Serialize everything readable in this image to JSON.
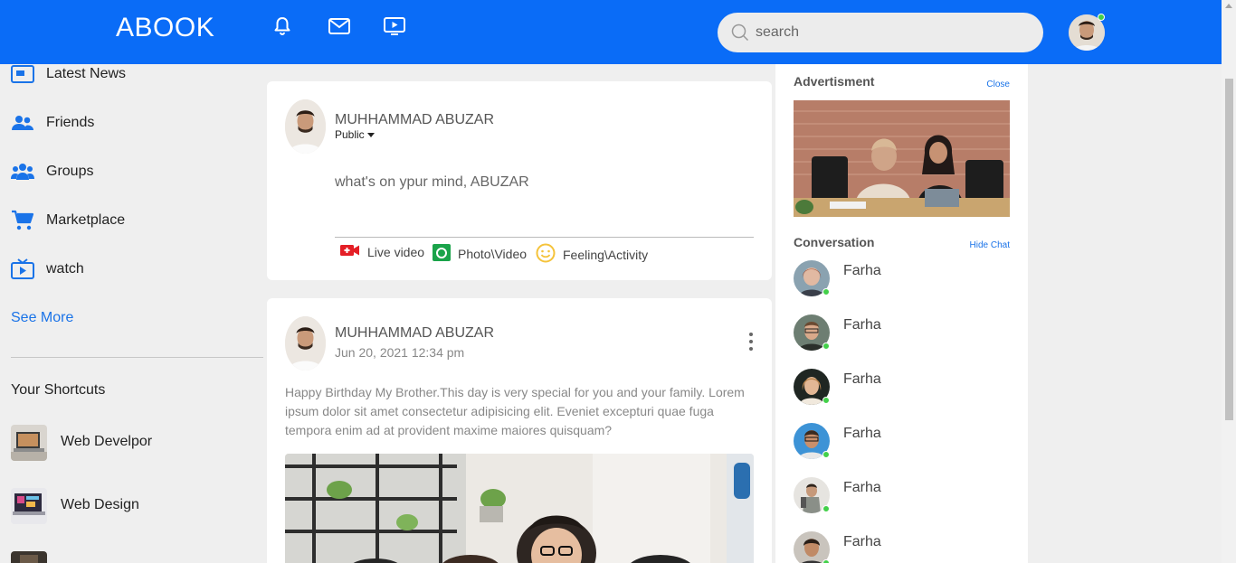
{
  "header": {
    "logo": "ABOOK",
    "icons": [
      "bell-icon",
      "mail-icon",
      "tv-icon"
    ],
    "search_placeholder": "search",
    "accent": "#0a6cf7"
  },
  "sidebar": {
    "items": [
      {
        "label": "Latest News",
        "icon": "news-icon"
      },
      {
        "label": "Friends",
        "icon": "friends-icon"
      },
      {
        "label": "Groups",
        "icon": "groups-icon"
      },
      {
        "label": "Marketplace",
        "icon": "cart-icon"
      },
      {
        "label": "watch",
        "icon": "watch-icon"
      }
    ],
    "see_more": "See More",
    "shortcuts_title": "Your Shortcuts",
    "shortcuts": [
      {
        "label": "Web Develpor"
      },
      {
        "label": "Web Design"
      }
    ]
  },
  "composer": {
    "author": "MUHHAMMAD ABUZAR",
    "visibility": "Public",
    "prompt": "what's on ypur mind, ABUZAR",
    "actions": [
      {
        "label": "Live video",
        "icon": "live-video-icon",
        "color": "#e41e26"
      },
      {
        "label": "Photo\\Video",
        "icon": "photo-icon",
        "color": "#1aa34a"
      },
      {
        "label": "Feeling\\Activity",
        "icon": "smiley-icon",
        "color": "#f5c33b"
      }
    ]
  },
  "post": {
    "author": "MUHHAMMAD ABUZAR",
    "date": "Jun 20, 2021 12:34 pm",
    "text": "Happy Birthday My Brother.This day is very special for you and your family. Lorem ipsum dolor sit amet consectetur adipisicing elit. Eveniet excepturi quae fuga tempora enim ad at provident maxime maiores quisquam?"
  },
  "right_panel": {
    "ad_title": "Advertisment",
    "ad_close": "Close",
    "conversation_title": "Conversation",
    "hide_chat": "Hide Chat",
    "contacts": [
      {
        "name": "Farha"
      },
      {
        "name": "Farha"
      },
      {
        "name": "Farha"
      },
      {
        "name": "Farha"
      },
      {
        "name": "Farha"
      },
      {
        "name": "Farha"
      }
    ]
  }
}
